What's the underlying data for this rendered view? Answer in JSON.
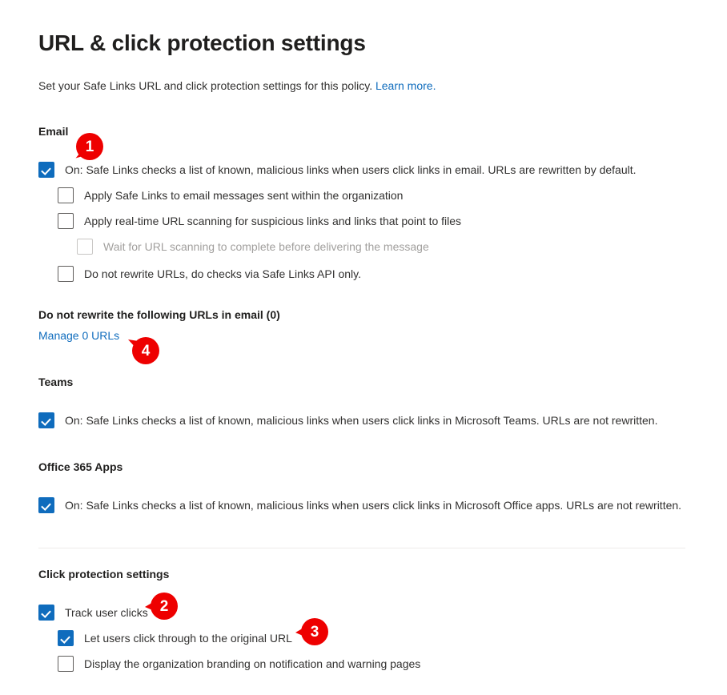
{
  "page": {
    "title": "URL & click protection settings",
    "subtitle_text": "Set your Safe Links URL and click protection settings for this policy.",
    "subtitle_link": "Learn more."
  },
  "colors": {
    "accent": "#0f6cbd",
    "link": "#0f6cbd",
    "badge": "#ee0000",
    "text": "#323130",
    "divider": "#edebe9",
    "disabled_text": "#a19f9d"
  },
  "email": {
    "section_label": "Email",
    "options": [
      {
        "label": "On: Safe Links checks a list of known, malicious links when users click links in email. URLs are rewritten by default.",
        "checked": true,
        "disabled": false,
        "indent": 0
      },
      {
        "label": "Apply Safe Links to email messages sent within the organization",
        "checked": false,
        "disabled": false,
        "indent": 1
      },
      {
        "label": "Apply real-time URL scanning for suspicious links and links that point to files",
        "checked": false,
        "disabled": false,
        "indent": 1
      },
      {
        "label": "Wait for URL scanning to complete before delivering the message",
        "checked": false,
        "disabled": true,
        "indent": 2
      },
      {
        "label": "Do not rewrite URLs, do checks via Safe Links API only.",
        "checked": false,
        "disabled": false,
        "indent": 1
      }
    ],
    "rewrite_label": "Do not rewrite the following URLs in email (0)",
    "manage_link": "Manage 0 URLs"
  },
  "teams": {
    "section_label": "Teams",
    "option": {
      "label": "On: Safe Links checks a list of known, malicious links when users click links in Microsoft Teams. URLs are not rewritten.",
      "checked": true
    }
  },
  "office": {
    "section_label": "Office 365 Apps",
    "option": {
      "label": "On: Safe Links checks a list of known, malicious links when users click links in Microsoft Office apps. URLs are not rewritten.",
      "checked": true
    }
  },
  "click_protection": {
    "section_label": "Click protection settings",
    "options": [
      {
        "label": "Track user clicks",
        "checked": true,
        "indent": 0
      },
      {
        "label": "Let users click through to the original URL",
        "checked": true,
        "indent": 1
      },
      {
        "label": "Display the organization branding on notification and warning pages",
        "checked": false,
        "indent": 1
      }
    ]
  },
  "callouts": [
    {
      "number": "1",
      "tail": "down-left"
    },
    {
      "number": "4",
      "tail": "up-left"
    },
    {
      "number": "2",
      "tail": "left"
    },
    {
      "number": "3",
      "tail": "left"
    }
  ]
}
